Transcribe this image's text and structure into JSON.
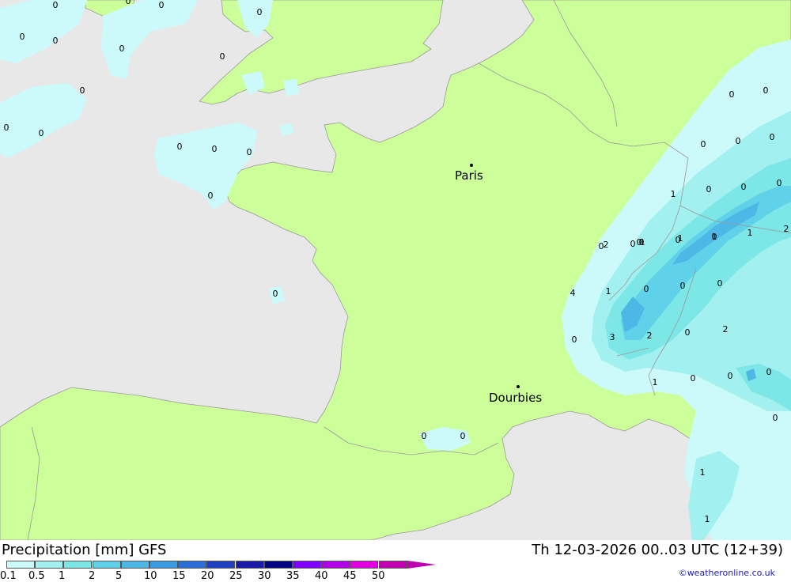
{
  "map": {
    "cities": [
      {
        "name": "Paris"
      },
      {
        "name": "Dourbies"
      }
    ],
    "precip_labels": [
      "0",
      "0",
      "0",
      "0",
      "0",
      "0",
      "0",
      "0",
      "0",
      "0",
      "0",
      "0",
      "0",
      "0",
      "0",
      "0",
      "0",
      "0",
      "0",
      "0",
      "0",
      "0",
      "0",
      "0",
      "0",
      "1",
      "0",
      "0",
      "1",
      "1",
      "2",
      "2",
      "1",
      "4",
      "1",
      "0",
      "0",
      "0",
      "0",
      "3",
      "2",
      "0",
      "2",
      "1",
      "0",
      "0",
      "0",
      "0",
      "1",
      "1",
      "0",
      "1",
      "0",
      "0",
      "0",
      "0"
    ],
    "colors": {
      "sea": "#e8e8e8",
      "land": "#ccff99",
      "border": "#999999",
      "precip_01": "#ccfafa",
      "precip_05": "#a3f0f0",
      "precip_1": "#7de6e6",
      "precip_2": "#5fd1e8",
      "precip_5": "#4db8e6"
    }
  },
  "footer": {
    "title": "Precipitation [mm] GFS",
    "datetime": "Th 12-03-2026 00..03 UTC (12+39)",
    "credit": "©weatheronline.co.uk",
    "legend": {
      "ticks": [
        "0.1",
        "0.5",
        "1",
        "2",
        "5",
        "10",
        "15",
        "20",
        "25",
        "30",
        "35",
        "40",
        "45",
        "50"
      ],
      "colors": [
        "#ccfafa",
        "#a3f0f0",
        "#7de6e6",
        "#5fd1e8",
        "#4db8e6",
        "#3a9be0",
        "#2b6fd6",
        "#2040c0",
        "#1a1aa8",
        "#000080",
        "#8000ff",
        "#b000e6",
        "#e000e0",
        "#c000b0"
      ]
    }
  }
}
